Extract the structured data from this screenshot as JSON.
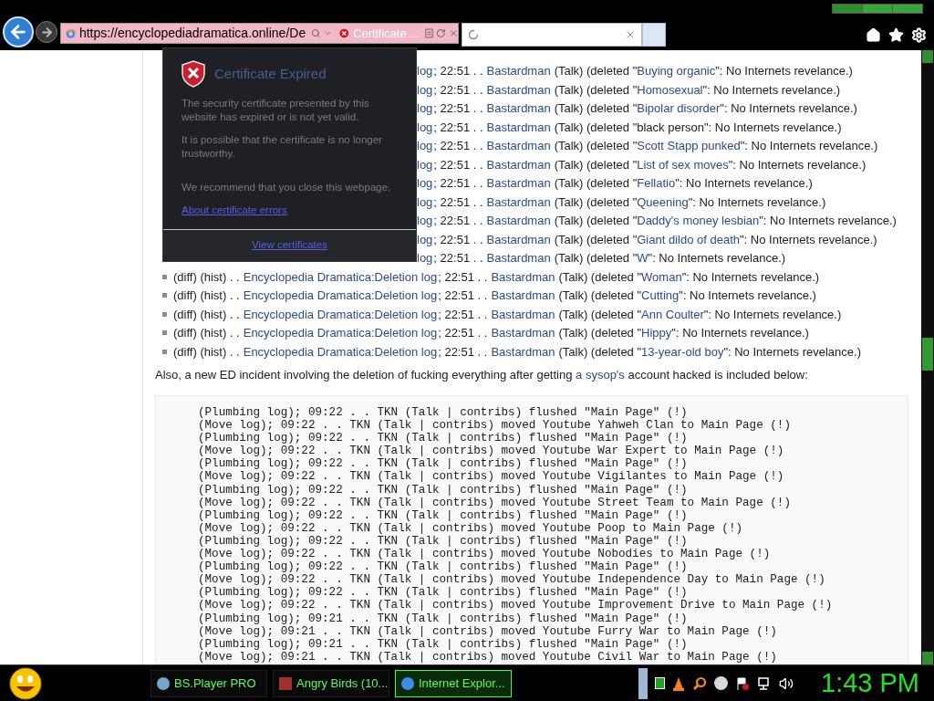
{
  "browser": {
    "address": "https://encyclopediadramatica.online/De",
    "tab_title": "Certificate ..."
  },
  "certificate_popup": {
    "title": "Certificate Expired",
    "paragraphs": [
      "The security certificate presented by this website has expired or is not yet valid.",
      "It is possible that the certificate is no longer trustworthy.",
      "We recommend that you close this webpage."
    ],
    "link": "About certificate errors",
    "button": "View certificates"
  },
  "log": [
    {
      "link": "log",
      "time": "; 22:51 . .",
      "user": "Bastardman",
      "talk": "(Talk) (deleted \"",
      "title": "Buying organic",
      "reason": "\": No Internets revelance.)"
    },
    {
      "link": "log",
      "time": "; 22:51 . .",
      "user": "Bastardman",
      "talk": "(Talk) (deleted \"",
      "title": "Homosexual",
      "reason": "\": No Internets revelance.)"
    },
    {
      "link": "log",
      "time": "; 22:51 . .",
      "user": "Bastardman",
      "talk": "(Talk) (deleted \"",
      "title": "Bipolar disorder",
      "reason": "\": No Internets revelance.)"
    },
    {
      "link": "log",
      "time": "; 22:51 . .",
      "user": "Bastardman",
      "talk": "(Talk) (deleted \"black person\": No Internets revelance.)"
    },
    {
      "link": "log",
      "time": "; 22:51 . .",
      "user": "Bastardman",
      "talk": "(Talk) (deleted \"",
      "title": "Scott Stapp punked",
      "reason": "\": No Internets revelance.)"
    },
    {
      "link": "log",
      "time": "; 22:51 . .",
      "user": "Bastardman",
      "talk": "(Talk) (deleted \"",
      "title": "List of sex moves",
      "reason": "\": No Internets revelance.)"
    },
    {
      "link": "log",
      "time": "; 22:51 . .",
      "user": "Bastardman",
      "talk": "(Talk) (deleted \"",
      "title": "Fellatio",
      "reason": "\": No Internets revelance.)"
    },
    {
      "link": "log",
      "time": "; 22:51 . .",
      "user": "Bastardman",
      "talk": "(Talk) (deleted \"",
      "title": "Queening",
      "reason": "\": No Internets revelance.)"
    },
    {
      "link": "log",
      "time": "; 22:51 . .",
      "user": "Bastardman",
      "talk": "(Talk) (deleted \"",
      "title": "Daddy's money lesbian",
      "reason": "\": No Internets revelance.)"
    },
    {
      "link": "log",
      "time": "; 22:51 . .",
      "user": "Bastardman",
      "talk": "(Talk) (deleted \"",
      "title": "Giant dildo of death",
      "reason": "\": No Internets revelance.)"
    },
    {
      "link": "log",
      "time": "; 22:51 . .",
      "user": "Bastardman",
      "talk": "(Talk) (deleted \"",
      "title": "W",
      "reason": "\": No Internets revelance.)"
    },
    {
      "prefix": "(diff) (hist) . .",
      "link": "Encyclopedia Dramatica:Deletion log",
      "time": "; 22:51 . .",
      "user": "Bastardman",
      "talk": "(Talk) (deleted \"",
      "title": "Woman",
      "reason": "\": No Internets revelance.)"
    },
    {
      "prefix": "(diff) (hist) . .",
      "link": "Encyclopedia Dramatica:Deletion log",
      "time": "; 22:51 . .",
      "user": "Bastardman",
      "talk": "(Talk) (deleted \"",
      "title": "Cutting",
      "reason": "\": No Internets revelance.)"
    },
    {
      "prefix": "(diff) (hist) . .",
      "link": "Encyclopedia Dramatica:Deletion log",
      "time": "; 22:51 . .",
      "user": "Bastardman",
      "talk": "(Talk) (deleted \"",
      "title": "Ann Coulter",
      "reason": "\": No Internets revelance.)"
    },
    {
      "prefix": "(diff) (hist) . .",
      "link": "Encyclopedia Dramatica:Deletion log",
      "time": "; 22:51 . .",
      "user": "Bastardman",
      "talk": "(Talk) (deleted \"",
      "title": "Hippy",
      "reason": "\": No Internets revelance.)"
    },
    {
      "prefix": "(diff) (hist) . .",
      "link": "Encyclopedia Dramatica:Deletion log",
      "time": "; 22:51 . .",
      "user": "Bastardman",
      "talk": "(Talk) (deleted \"",
      "title": "13-year-old boy",
      "reason": "\": No Internets revelance.)"
    }
  ],
  "paragraph": {
    "before": "Also, a new ED incident involving the deletion of fucking everything after getting ",
    "link": "a sysop's",
    "after": " account hacked is included below:"
  },
  "code_lines": [
    "(Plumbing log); 09:22 . . TKN (Talk | contribs) flushed \"Main Page\" (!)",
    "(Move log); 09:22 . . TKN (Talk | contribs) moved Youtube Yahweh Clan to Main Page (!)",
    "(Plumbing log); 09:22 . . TKN (Talk | contribs) flushed \"Main Page\" (!)",
    "(Move log); 09:22 . . TKN (Talk | contribs) moved Youtube War Expert to Main Page (!)",
    "(Plumbing log); 09:22 . . TKN (Talk | contribs) flushed \"Main Page\" (!)",
    "(Move log); 09:22 . . TKN (Talk | contribs) moved Youtube Vigilantes to Main Page (!)",
    "(Plumbing log); 09:22 . . TKN (Talk | contribs) flushed \"Main Page\" (!)",
    "(Move log); 09:22 . . TKN (Talk | contribs) moved Youtube Street Team to Main Page (!)",
    "(Plumbing log); 09:22 . . TKN (Talk | contribs) flushed \"Main Page\" (!)",
    "(Move log); 09:22 . . TKN (Talk | contribs) moved Youtube Poop to Main Page (!)",
    "(Plumbing log); 09:22 . . TKN (Talk | contribs) flushed \"Main Page\" (!)",
    "(Move log); 09:22 . . TKN (Talk | contribs) moved Youtube Nobodies to Main Page (!)",
    "(Plumbing log); 09:22 . . TKN (Talk | contribs) flushed \"Main Page\" (!)",
    "(Move log); 09:22 . . TKN (Talk | contribs) moved Youtube Independence Day to Main Page (!)",
    "(Plumbing log); 09:22 . . TKN (Talk | contribs) flushed \"Main Page\" (!)",
    "(Move log); 09:22 . . TKN (Talk | contribs) moved Youtube Improvement Drive to Main Page (!)",
    "(Plumbing log); 09:21 . . TKN (Talk | contribs) flushed \"Main Page\" (!)",
    "(Move log); 09:21 . . TKN (Talk | contribs) moved Youtube Furry War to Main Page (!)",
    "(Plumbing log); 09:21 . . TKN (Talk | contribs) flushed \"Main Page\" (!)",
    "(Move log); 09:21 . . TKN (Talk | contribs) moved Youtube Civil War to Main Page (!)"
  ],
  "taskbar": {
    "tasks": [
      {
        "label": "BS.Player PRO",
        "selected": false
      },
      {
        "label": "Angry Birds (10...",
        "selected": false
      },
      {
        "label": "Internet Explor...",
        "selected": true
      }
    ],
    "clock": "1:43 PM"
  }
}
